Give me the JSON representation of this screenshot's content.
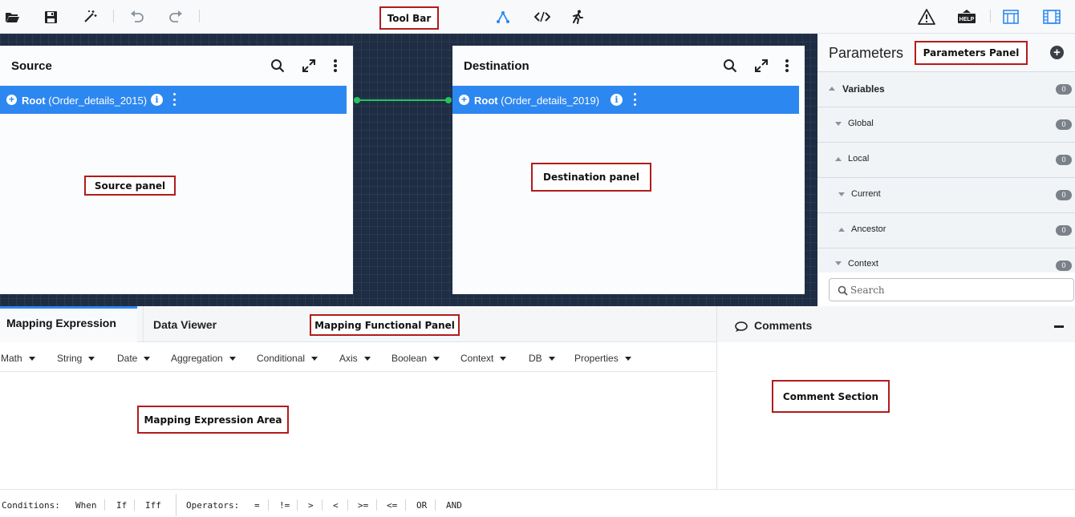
{
  "toolbar": {
    "open": "folder-open-icon",
    "save": "save-icon",
    "magic": "magic-wand-icon",
    "undo": "undo-icon",
    "redo": "redo-icon",
    "mapping": "mapping-icon",
    "code": "code-icon",
    "run": "run-icon",
    "warning": "warning-icon",
    "help_label": "HELP",
    "layout1": "layout-icon",
    "layout2": "film-layout-icon"
  },
  "annotations": {
    "toolbar": "Tool Bar",
    "parameters": "Parameters Panel",
    "source": "Source panel",
    "destination": "Destination panel",
    "functional": "Mapping Functional Panel",
    "expression": "Mapping Expression Area",
    "comment": "Comment Section"
  },
  "source": {
    "title": "Source",
    "root_label": "Root",
    "root_name": "(Order_details_2015)"
  },
  "destination": {
    "title": "Destination",
    "root_label": "Root",
    "root_name": "(Order_details_2019)"
  },
  "parameters": {
    "title": "Parameters",
    "search_placeholder": "Search",
    "items": [
      {
        "label": "Variables",
        "count": "0"
      },
      {
        "label": "Global",
        "count": "0"
      },
      {
        "label": "Local",
        "count": "0"
      },
      {
        "label": "Current",
        "count": "0"
      },
      {
        "label": "Ancestor",
        "count": "0"
      },
      {
        "label": "Context",
        "count": "0"
      }
    ]
  },
  "tabs": {
    "mapping_expression": "Mapping Expression",
    "data_viewer": "Data Viewer"
  },
  "functions": [
    "Math",
    "String",
    "Date",
    "Aggregation",
    "Conditional",
    "Axis",
    "Boolean",
    "Context",
    "DB",
    "Properties"
  ],
  "comments": {
    "title": "Comments",
    "collapse": "−"
  },
  "conditions": {
    "label": "Conditions:",
    "items": [
      "When",
      "If",
      "Iff"
    ]
  },
  "operators": {
    "label": "Operators:",
    "items": [
      "=",
      "!=",
      ">",
      "<",
      ">=",
      "<=",
      "OR",
      "AND"
    ]
  },
  "colors": {
    "accent": "#2d87f0",
    "canvas": "#1f2d44",
    "connector": "#22c55e",
    "annotation_border": "#b31b1b"
  }
}
